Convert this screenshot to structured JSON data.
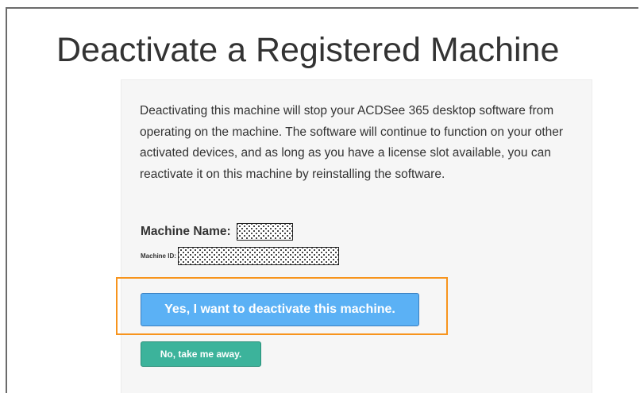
{
  "page": {
    "title": "Deactivate a Registered Machine"
  },
  "card": {
    "description": "Deactivating this machine will stop your ACDSee 365 desktop software from operating on the machine. The software will continue to function on your other activated devices, and as long as you have a license slot available, you can reactivate it on this machine by reinstalling the software.",
    "machine_name_label": "Machine Name:",
    "machine_id_label": "Machine ID:"
  },
  "actions": {
    "deactivate_label": "Yes, I want to deactivate this machine.",
    "cancel_label": "No, take me away."
  },
  "colors": {
    "deactivate_button": "#5bb1f5",
    "cancel_button": "#3cb39b",
    "highlight_outline": "#f7941d"
  }
}
